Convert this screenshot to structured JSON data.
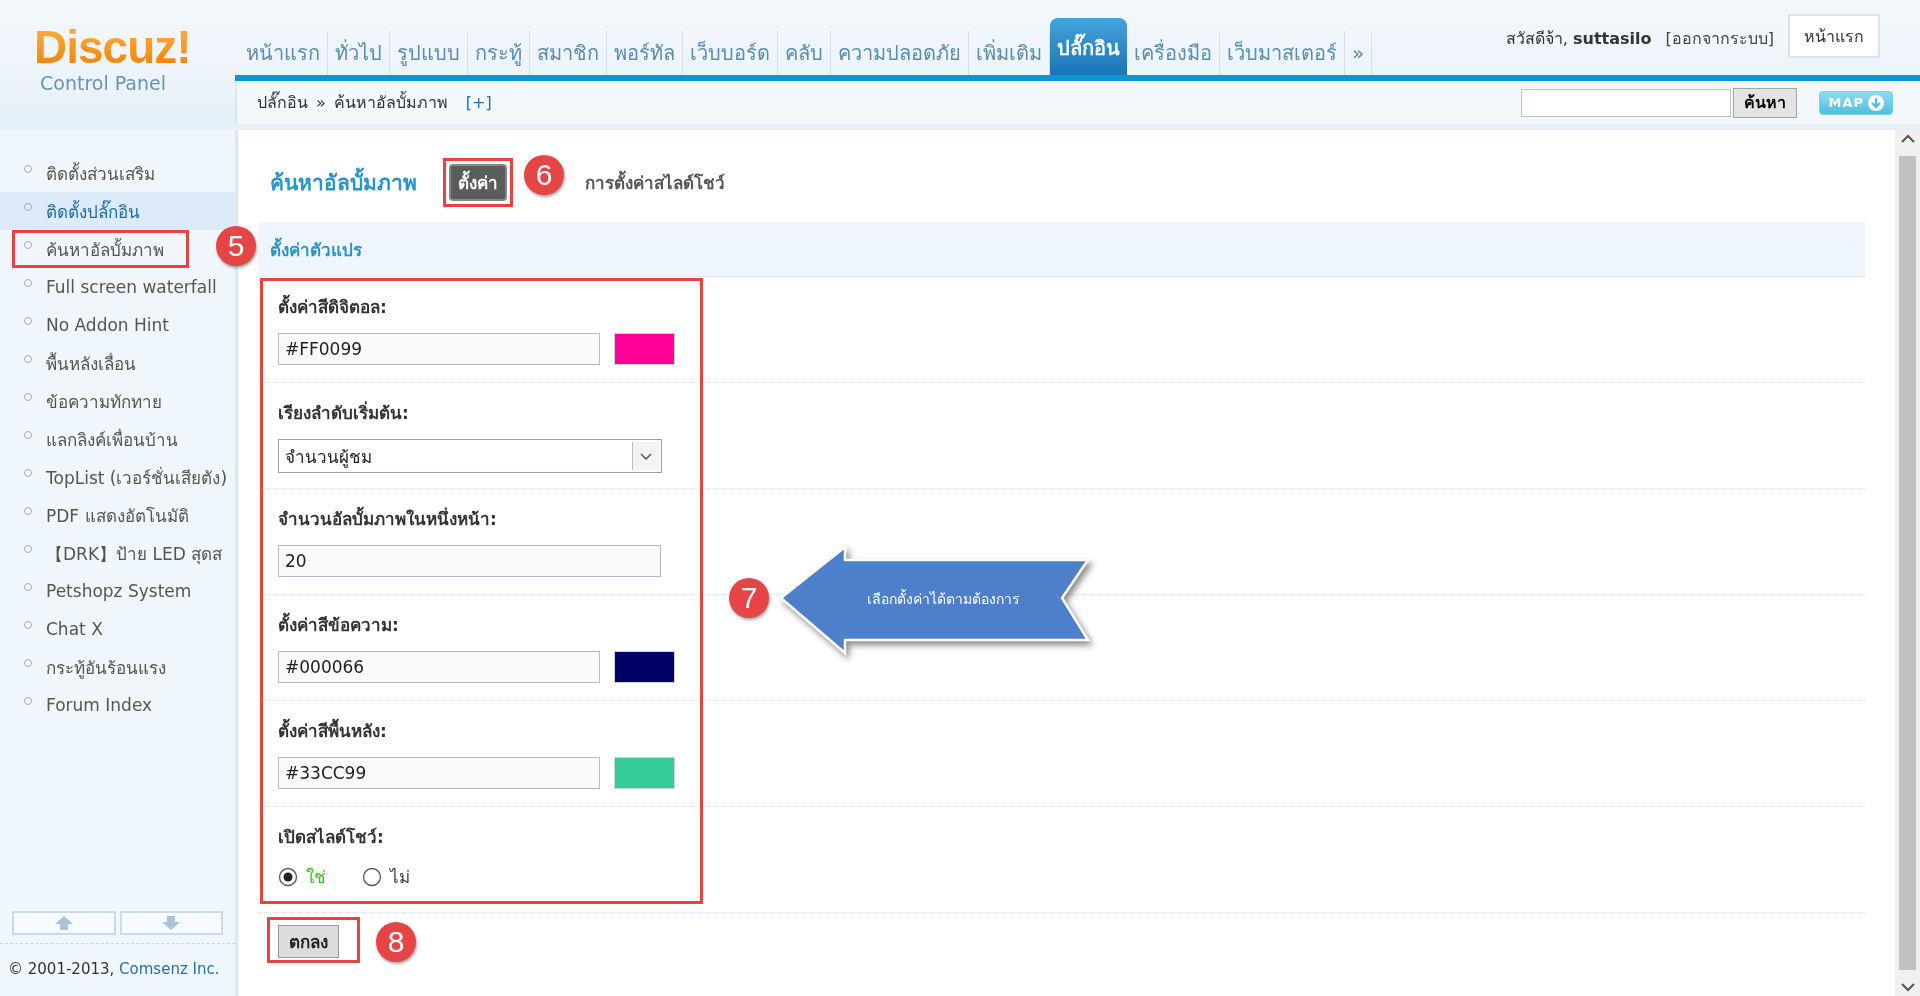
{
  "logo": {
    "title": "Discuz!",
    "subtitle": "Control Panel"
  },
  "nav": {
    "items": [
      {
        "label": "หน้าแรก",
        "selected": false
      },
      {
        "label": "ทั่วไป",
        "selected": false
      },
      {
        "label": "รูปแบบ",
        "selected": false
      },
      {
        "label": "กระทู้",
        "selected": false
      },
      {
        "label": "สมาชิก",
        "selected": false
      },
      {
        "label": "พอร์ทัล",
        "selected": false
      },
      {
        "label": "เว็บบอร์ด",
        "selected": false
      },
      {
        "label": "คลับ",
        "selected": false
      },
      {
        "label": "ความปลอดภัย",
        "selected": false
      },
      {
        "label": "เพิ่มเติม",
        "selected": false
      },
      {
        "label": "ปลั๊กอิน",
        "selected": true
      },
      {
        "label": "เครื่องมือ",
        "selected": false
      },
      {
        "label": "เว็บมาสเตอร์",
        "selected": false
      },
      {
        "label": "»",
        "selected": false
      }
    ]
  },
  "user": {
    "greeting": "สวัสดีจ้า,",
    "username": "suttasilo",
    "logout": "[ออกจากระบบ]",
    "home_button": "หน้าแรก"
  },
  "breadcrumb": {
    "items": [
      "ปลั๊กอิน",
      "ค้นหาอัลบั้มภาพ"
    ],
    "separator": "»",
    "add": "[+]"
  },
  "search": {
    "button": "ค้นหา"
  },
  "map_button": "MAP",
  "sidebar": {
    "items": [
      {
        "label": "ติดตั้งส่วนเสริม",
        "selected": false
      },
      {
        "label": "ติดตั้งปลั๊กอิน",
        "selected": true
      },
      {
        "label": "ค้นหาอัลบั้มภาพ",
        "selected": false,
        "highlighted": true
      },
      {
        "label": "Full screen waterfall",
        "selected": false
      },
      {
        "label": "No Addon Hint",
        "selected": false
      },
      {
        "label": "พื้นหลังเลื่อน",
        "selected": false
      },
      {
        "label": "ข้อความทักทาย",
        "selected": false
      },
      {
        "label": "แลกลิงค์เพื่อนบ้าน",
        "selected": false
      },
      {
        "label": "TopList (เวอร์ชั่นเสียตัง)",
        "selected": false
      },
      {
        "label": "PDF แสดงอัตโนมัติ",
        "selected": false
      },
      {
        "label": "【DRK】ป้าย LED สุดส",
        "selected": false
      },
      {
        "label": "Petshopz System",
        "selected": false
      },
      {
        "label": "Chat X",
        "selected": false
      },
      {
        "label": "กระทู้อันร้อนแรง",
        "selected": false
      },
      {
        "label": "Forum Index",
        "selected": false
      }
    ]
  },
  "footer": {
    "copyright": "© 2001-2013,",
    "company": "Comsenz Inc."
  },
  "page": {
    "title": "ค้นหาอัลบั้มภาพ",
    "tabs": [
      {
        "label": "ตั้งค่า",
        "selected": true,
        "highlighted": true
      },
      {
        "label": "การตั้งค่าสไลด์โชว์",
        "selected": false
      }
    ]
  },
  "section": {
    "title": "ตั้งค่าตัวแปร"
  },
  "fields": [
    {
      "kind": "color",
      "label": "ตั้งค่าสีดิจิตอล:",
      "value": "#FF0099",
      "color": "#ff0099"
    },
    {
      "kind": "select",
      "label": "เรียงลำดับเริ่มต้น:",
      "value": "จำนวนผู้ชม"
    },
    {
      "kind": "text",
      "label": "จำนวนอัลบั้มภาพในหนึ่งหน้า:",
      "value": "20"
    },
    {
      "kind": "color",
      "label": "ตั้งค่าสีข้อความ:",
      "value": "#000066",
      "color": "#000066"
    },
    {
      "kind": "color",
      "label": "ตั้งค่าสีพื้นหลัง:",
      "value": "#33CC99",
      "color": "#33cc99"
    },
    {
      "kind": "radio",
      "label": "เปิดสไลด์โชว์:",
      "options": [
        {
          "label": "ใช่",
          "selected": true
        },
        {
          "label": "ไม่",
          "selected": false
        }
      ]
    }
  ],
  "submit": "ตกลง",
  "annotations": [
    {
      "kind": "badge",
      "number": "5"
    },
    {
      "kind": "badge",
      "number": "6"
    },
    {
      "kind": "callout",
      "number": "7",
      "text": "เลือกตั้งค่าได้ตามต้องการ"
    },
    {
      "kind": "badge",
      "number": "8"
    }
  ]
}
